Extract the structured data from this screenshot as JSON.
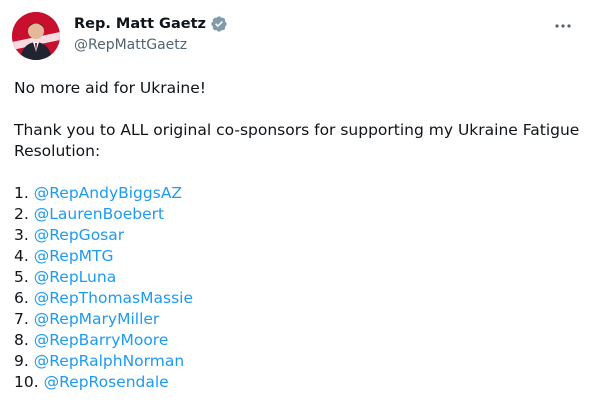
{
  "author": {
    "name": "Rep. Matt Gaetz",
    "handle": "@RepMattGaetz",
    "verified_color": "#829aab",
    "avatar_icon": "avatar-photo"
  },
  "menu_icon": "more-horizontal-icon",
  "tweet": {
    "line1": "No more aid for Ukraine!",
    "line2": "Thank you to ALL original co-sponsors for supporting my Ukraine Fatigue Resolution:",
    "cosponsors": [
      {
        "number": "1.",
        "handle": "@RepAndyBiggsAZ"
      },
      {
        "number": "2.",
        "handle": "@LaurenBoebert"
      },
      {
        "number": "3.",
        "handle": "@RepGosar"
      },
      {
        "number": "4.",
        "handle": "@RepMTG"
      },
      {
        "number": "5.",
        "handle": "@RepLuna"
      },
      {
        "number": "6.",
        "handle": "@RepThomasMassie"
      },
      {
        "number": "7.",
        "handle": "@RepMaryMiller"
      },
      {
        "number": "8.",
        "handle": "@RepBarryMoore"
      },
      {
        "number": "9.",
        "handle": "@RepRalphNorman"
      },
      {
        "number": "10.",
        "handle": "@RepRosendale"
      }
    ]
  },
  "colors": {
    "text": "#0f1419",
    "secondary": "#536471",
    "link": "#1d9bf0"
  }
}
